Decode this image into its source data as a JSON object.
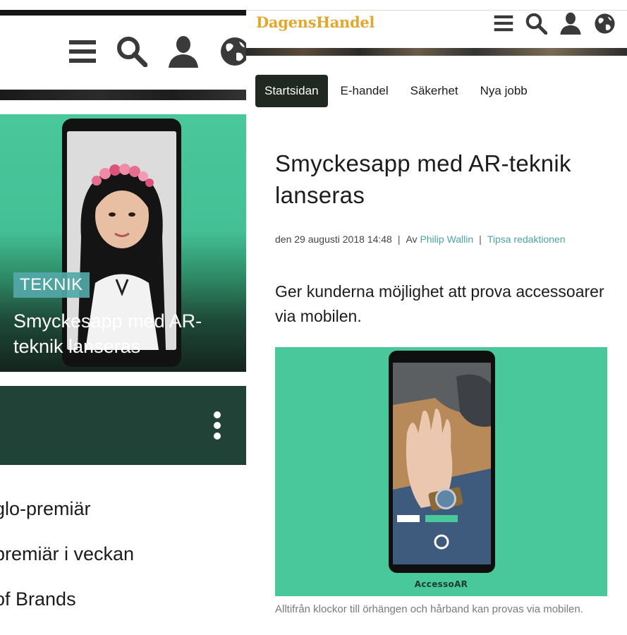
{
  "left": {
    "hero": {
      "tag": "TEKNIK",
      "title": "Smyckesapp med AR-teknik lanseras"
    },
    "list": [
      "glo-premiär",
      "premiär i veckan",
      "of Brands"
    ],
    "icons": [
      "menu-icon",
      "search-icon",
      "user-icon",
      "globe-icon",
      "more-vertical-icon"
    ]
  },
  "right": {
    "logo": "DagensHandel",
    "nav": {
      "tabs": [
        "Startsidan",
        "E-handel",
        "Säkerhet",
        "Nya jobb"
      ],
      "active": "Startsidan"
    },
    "article": {
      "headline": "Smyckesapp med AR-teknik lanseras",
      "date": "den 29 augusti 2018 14:48",
      "by": "Av",
      "author": "Philip Wallin",
      "tip_link": "Tipsa redaktionen",
      "lead": "Ger kunderna möjlighet att prova accessoarer via mobilen.",
      "figure_brand": "AccessoAR",
      "caption": "Alltifrån klockor till örhängen och hårband kan provas via mobilen."
    },
    "colors": {
      "logo": "#e3a72b",
      "accent_green": "#48c89b",
      "dark_green": "#204237",
      "link": "#4aa3a2",
      "active_tab": "#1f2921"
    }
  }
}
